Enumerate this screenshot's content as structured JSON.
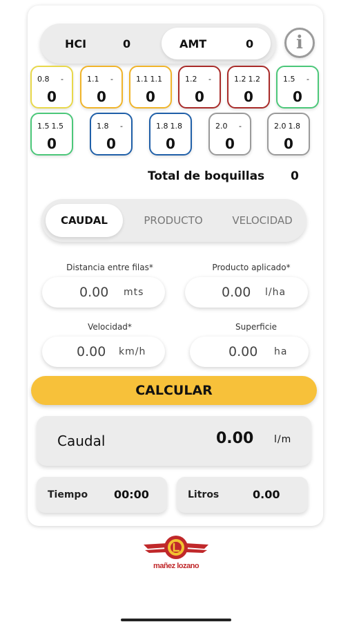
{
  "mode_toggle": {
    "hci_label": "HCI",
    "hci_value": "0",
    "amt_label": "AMT",
    "amt_value": "0"
  },
  "info_icon": "info-icon",
  "nozzles": [
    {
      "a": "0.8",
      "b": "-",
      "count": "0",
      "color": "#e8d84a"
    },
    {
      "a": "1.1",
      "b": "-",
      "count": "0",
      "color": "#f0b429"
    },
    {
      "a": "1.1",
      "b": "1.1",
      "count": "0",
      "color": "#f0b429"
    },
    {
      "a": "1.2",
      "b": "-",
      "count": "0",
      "color": "#a82a28"
    },
    {
      "a": "1.2",
      "b": "1.2",
      "count": "0",
      "color": "#a82a28"
    },
    {
      "a": "1.5",
      "b": "-",
      "count": "0",
      "color": "#4bc779"
    },
    {
      "a": "1.5",
      "b": "1.5",
      "count": "0",
      "color": "#4bc779"
    },
    {
      "a": "1.8",
      "b": "-",
      "count": "0",
      "color": "#1f5fa8"
    },
    {
      "a": "1.8",
      "b": "1.8",
      "count": "0",
      "color": "#1f5fa8"
    },
    {
      "a": "2.0",
      "b": "-",
      "count": "0",
      "color": "#9a9a9a"
    },
    {
      "a": "2.0",
      "b": "1.8",
      "count": "0",
      "color": "#9a9a9a"
    }
  ],
  "total": {
    "label": "Total de boquillas",
    "value": "0"
  },
  "tabs": [
    "CAUDAL",
    "PRODUCTO",
    "VELOCIDAD"
  ],
  "fields": {
    "distancia": {
      "label": "Distancia entre filas*",
      "value": "0.00",
      "unit": "mts"
    },
    "producto": {
      "label": "Producto aplicado*",
      "value": "0.00",
      "unit": "l/ha"
    },
    "velocidad": {
      "label": "Velocidad*",
      "value": "0.00",
      "unit": "km/h"
    },
    "superficie": {
      "label": "Superficie",
      "value": "0.00",
      "unit": "ha"
    }
  },
  "calc_button": "CALCULAR",
  "result_main": {
    "label": "Caudal",
    "value": "0.00",
    "unit": "l/m"
  },
  "result_tiempo": {
    "label": "Tiempo",
    "value": "00:00"
  },
  "result_litros": {
    "label": "Litros",
    "value": "0.00"
  },
  "logo_text": "mañez lozano"
}
